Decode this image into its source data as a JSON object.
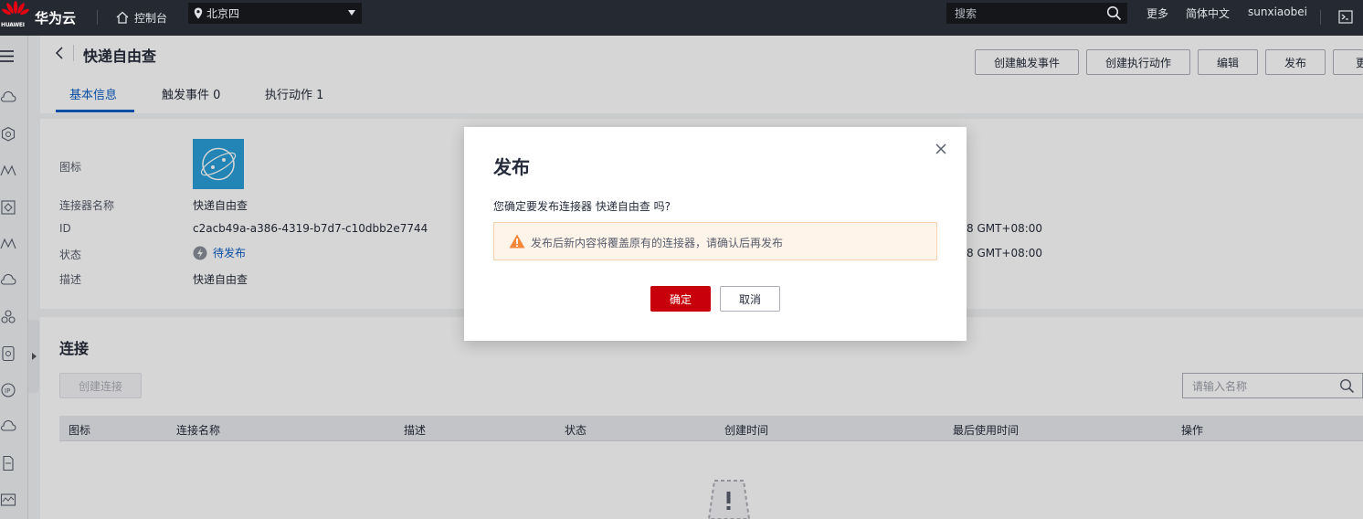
{
  "topbar": {
    "logo_text": "HUAWEI",
    "brand": "华为云",
    "console": "控制台",
    "region": "北京四",
    "search_placeholder": "搜索",
    "more": "更多",
    "language": "简体中文",
    "username": "sunxiaobei",
    "icons": [
      "home-icon",
      "location-pin-icon",
      "search-icon",
      "terminal-icon"
    ]
  },
  "header": {
    "title": "快递自由查",
    "buttons": [
      "创建触发事件",
      "创建执行动作",
      "编辑",
      "发布",
      "更"
    ],
    "tabs": [
      "基本信息",
      "触发事件 0",
      "执行动作 1"
    ]
  },
  "info": {
    "labels": [
      "图标",
      "连接器名称",
      "ID",
      "状态",
      "描述"
    ],
    "name": "快递自由查",
    "id": "c2acb49a-a386-4319-b7d7-c10dbb2e7744",
    "status": "待发布",
    "description": "快递自由查",
    "right_values": [
      "8 GMT+08:00",
      "8 GMT+08:00"
    ]
  },
  "connections": {
    "title": "连接",
    "create_button": "创建连接",
    "search_placeholder": "请输入名称",
    "columns": [
      "图标",
      "连接名称",
      "描述",
      "状态",
      "创建时间",
      "最后使用时间",
      "操作"
    ]
  },
  "modal": {
    "title": "发布",
    "message": "您确定要发布连接器 快递自由查 吗?",
    "warning": "发布后新内容将覆盖原有的连接器，请确认后再发布",
    "confirm": "确定",
    "cancel": "取消"
  },
  "colors": {
    "topbar": "#252a32",
    "brand_blue": "#0b5dc4",
    "confirm_red": "#c7000b",
    "warning_orange": "#f5873a",
    "warning_bg": "#fff4ea"
  }
}
